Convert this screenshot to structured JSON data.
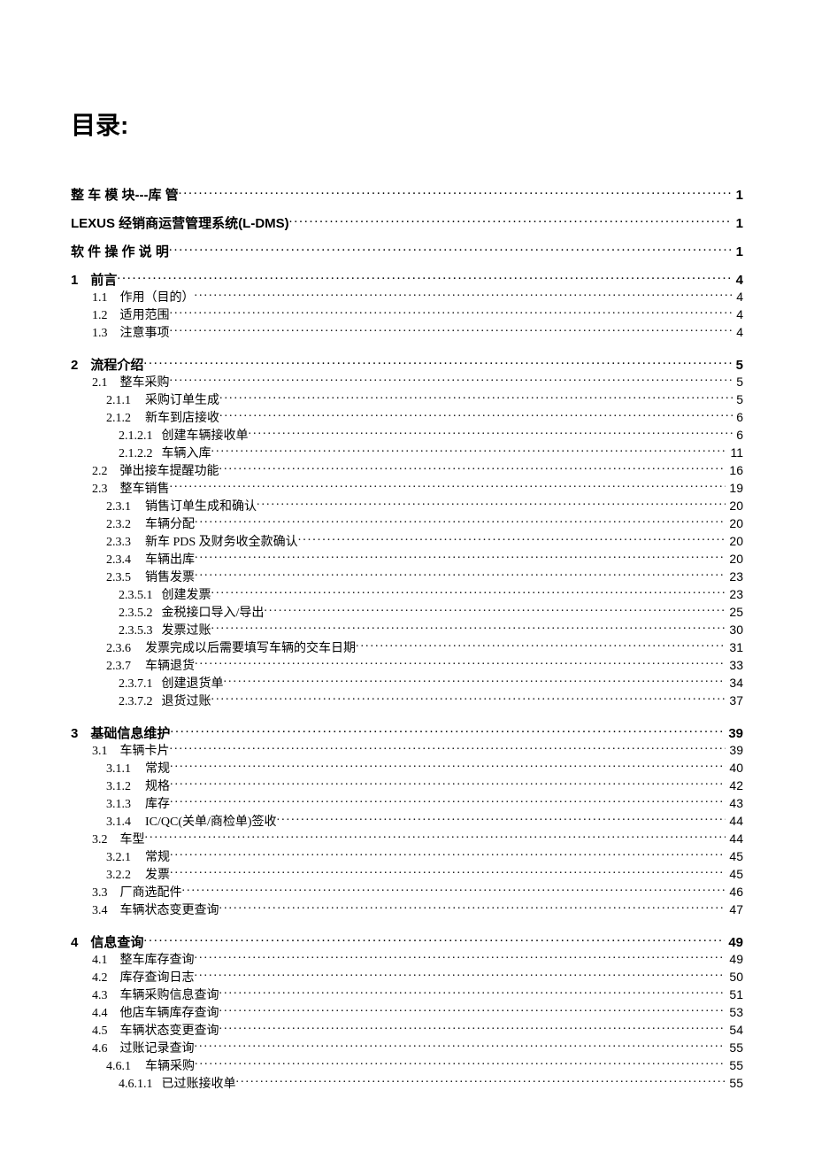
{
  "title": "目录:",
  "entries": [
    {
      "level": 0,
      "num": "",
      "text": "整  车  模  块---库  管",
      "page": "1",
      "spaced": false
    },
    {
      "level": 0,
      "num": "",
      "text": "LEXUS 经销商运营管理系统(L-DMS)",
      "page": "1"
    },
    {
      "level": 0,
      "num": "",
      "text": "软 件 操 作 说 明",
      "page": "1",
      "spaced": false
    },
    {
      "level": 0,
      "num": "1",
      "text": "前言",
      "page": "4",
      "block": true
    },
    {
      "level": 1,
      "num": "1.1",
      "text": "作用（目的）",
      "page": "4"
    },
    {
      "level": 1,
      "num": "1.2",
      "text": "适用范围",
      "page": "4"
    },
    {
      "level": 1,
      "num": "1.3",
      "text": "注意事项",
      "page": "4"
    },
    {
      "level": 0,
      "num": "2",
      "text": "流程介绍",
      "page": "5",
      "block": true
    },
    {
      "level": 1,
      "num": "2.1",
      "text": "整车采购",
      "page": "5"
    },
    {
      "level": 2,
      "num": "2.1.1",
      "text": "采购订单生成",
      "page": "5"
    },
    {
      "level": 2,
      "num": "2.1.2",
      "text": "新车到店接收",
      "page": "6"
    },
    {
      "level": 3,
      "num": "2.1.2.1",
      "text": "创建车辆接收单",
      "page": "6"
    },
    {
      "level": 3,
      "num": "2.1.2.2",
      "text": "车辆入库",
      "page": "11"
    },
    {
      "level": 1,
      "num": "2.2",
      "text": "弹出接车提醒功能",
      "page": "16"
    },
    {
      "level": 1,
      "num": "2.3",
      "text": "整车销售",
      "page": "19"
    },
    {
      "level": 2,
      "num": "2.3.1",
      "text": "销售订单生成和确认",
      "page": "20"
    },
    {
      "level": 2,
      "num": "2.3.2",
      "text": "车辆分配",
      "page": "20"
    },
    {
      "level": 2,
      "num": "2.3.3",
      "text": "新车 PDS 及财务收全款确认",
      "page": "20"
    },
    {
      "level": 2,
      "num": "2.3.4",
      "text": "车辆出库",
      "page": "20"
    },
    {
      "level": 2,
      "num": "2.3.5",
      "text": "销售发票",
      "page": "23"
    },
    {
      "level": 3,
      "num": "2.3.5.1",
      "text": "创建发票",
      "page": "23"
    },
    {
      "level": 3,
      "num": "2.3.5.2",
      "text": "金税接口导入/导出",
      "page": "25"
    },
    {
      "level": 3,
      "num": "2.3.5.3",
      "text": "发票过账",
      "page": "30"
    },
    {
      "level": 2,
      "num": "2.3.6",
      "text": "发票完成以后需要填写车辆的交车日期",
      "page": "31"
    },
    {
      "level": 2,
      "num": "2.3.7",
      "text": "车辆退货",
      "page": "33"
    },
    {
      "level": 3,
      "num": "2.3.7.1",
      "text": "创建退货单",
      "page": "34"
    },
    {
      "level": 3,
      "num": "2.3.7.2",
      "text": "退货过账",
      "page": "37"
    },
    {
      "level": 0,
      "num": "3",
      "text": "基础信息维护",
      "page": "39",
      "block": true
    },
    {
      "level": 1,
      "num": "3.1",
      "text": "车辆卡片",
      "page": "39"
    },
    {
      "level": 2,
      "num": "3.1.1",
      "text": "常规",
      "page": "40"
    },
    {
      "level": 2,
      "num": "3.1.2",
      "text": "规格",
      "page": "42"
    },
    {
      "level": 2,
      "num": "3.1.3",
      "text": "库存",
      "page": "43"
    },
    {
      "level": 2,
      "num": "3.1.4",
      "text": "IC/QC(关单/商检单)签收",
      "page": "44"
    },
    {
      "level": 1,
      "num": "3.2",
      "text": "车型",
      "page": "44"
    },
    {
      "level": 2,
      "num": "3.2.1",
      "text": "常规",
      "page": "45"
    },
    {
      "level": 2,
      "num": "3.2.2",
      "text": "发票",
      "page": "45"
    },
    {
      "level": 1,
      "num": "3.3",
      "text": "厂商选配件",
      "page": "46"
    },
    {
      "level": 1,
      "num": "3.4",
      "text": "车辆状态变更查询",
      "page": "47"
    },
    {
      "level": 0,
      "num": "4",
      "text": "信息查询",
      "page": "49",
      "block": true
    },
    {
      "level": 1,
      "num": "4.1",
      "text": "整车库存查询",
      "page": "49"
    },
    {
      "level": 1,
      "num": "4.2",
      "text": "库存查询日志",
      "page": "50"
    },
    {
      "level": 1,
      "num": "4.3",
      "text": "车辆采购信息查询",
      "page": "51"
    },
    {
      "level": 1,
      "num": "4.4",
      "text": "他店车辆库存查询",
      "page": "53"
    },
    {
      "level": 1,
      "num": "4.5",
      "text": "车辆状态变更查询",
      "page": "54"
    },
    {
      "level": 1,
      "num": "4.6",
      "text": "过账记录查询",
      "page": "55"
    },
    {
      "level": 2,
      "num": "4.6.1",
      "text": "车辆采购",
      "page": "55"
    },
    {
      "level": 3,
      "num": "4.6.1.1",
      "text": "已过账接收单",
      "page": "55"
    }
  ]
}
